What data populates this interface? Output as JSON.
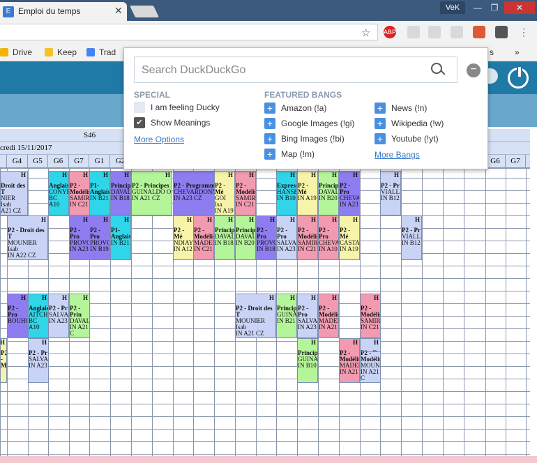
{
  "browser": {
    "tab_title": "Emploi du temps",
    "tab_icon": "E",
    "user_label": "VeK",
    "win_min": "—",
    "win_max": "❐",
    "win_close": "✕",
    "star_icon": "☆",
    "ext_abp": "ABP",
    "bookmarks": [
      {
        "label": "Drive",
        "color": "#f4b400"
      },
      {
        "label": "Keep",
        "color": "#f6c026"
      },
      {
        "label": "Trad",
        "color": "#4285f4"
      }
    ],
    "bookmark_partial": "s",
    "bookmark_more": "»"
  },
  "timetable": {
    "week_label": "S46",
    "date_label": "credi 15/11/2017",
    "groups_left": [
      "G4",
      "G5",
      "G6",
      "G7",
      "G1",
      "G2"
    ],
    "groups_right": [
      "G6",
      "G7"
    ]
  },
  "duckduckgo": {
    "search_placeholder": "Search DuckDuckGo",
    "minus_label": "−",
    "special_heading": "SPECIAL",
    "featured_heading": "FEATURED BANGS",
    "special_options": [
      {
        "label": "I am feeling Ducky",
        "checked": false
      },
      {
        "label": "Show Meanings",
        "checked": true
      }
    ],
    "more_options": "More Options",
    "bangs_col1": [
      "Amazon (!a)",
      "Google Images (!gi)",
      "Bing Images (!bi)",
      "Map (!m)"
    ],
    "bangs_col2": [
      "News (!n)",
      "Wikipedia (!w)",
      "Youtube (!yt)"
    ],
    "more_bangs": "More Bangs",
    "plus_symbol": "+",
    "check_symbol": "✔"
  },
  "events": [
    {
      "title": "Droit des T",
      "teacher": "NIER Isab",
      "room": "A21 CZ",
      "color": "#c9d3f5"
    },
    {
      "title": "Anglais",
      "teacher": "CONYB",
      "room": "BC A10",
      "color": "#2fd5e8"
    },
    {
      "title": "P2 - Modélis",
      "teacher": "SAMIR",
      "room": "IN C21",
      "color": "#f29ab0"
    },
    {
      "title": "P1- Anglais",
      "teacher": "",
      "room": "IN B21",
      "color": "#2fd5e8"
    },
    {
      "title": "Principe",
      "teacher": "DAVAL",
      "room": "IN B18",
      "color": "#8e7df0"
    },
    {
      "title": "P2 - Principes",
      "teacher": "GUINALDO O",
      "room": "IN A21 CZ",
      "color": "#b5f59a"
    },
    {
      "title": "P2 - Programm",
      "teacher": "CHEVARDONN",
      "room": "IN A23 CZ",
      "color": "#8e7df0"
    },
    {
      "title": "P2 - Mé",
      "teacher": "GOI Isa",
      "room": "IN A19",
      "color": "#f7f3a8"
    },
    {
      "title": "P2 - Modélis",
      "teacher": "SAMIR",
      "room": "IN C21",
      "color": "#f29ab0"
    },
    {
      "title": "Express",
      "teacher": "HANSE",
      "room": "IN B10",
      "color": "#2fd5e8"
    },
    {
      "title": "P2 - Mé",
      "teacher": "",
      "room": "IN A19",
      "color": "#f7f3a8"
    },
    {
      "title": "Princip",
      "teacher": "DAVAL",
      "room": "IN B20",
      "color": "#b5f59a"
    },
    {
      "title": "P2 - Pro",
      "teacher": "CHEVA",
      "room": "IN A23",
      "color": "#8e7df0"
    },
    {
      "title": "P2 - Pr",
      "teacher": "VIALLE",
      "room": "IN B12",
      "color": "#c9d3f5"
    },
    {
      "title": "P2 - Droit des T",
      "teacher": "MOUNIER Isab",
      "room": "IN A22 CZ",
      "color": "#c9d3f5"
    },
    {
      "title": "P2 - Pro",
      "teacher": "PROVO",
      "room": "IN A23",
      "color": "#8e7df0"
    },
    {
      "title": "P2 - Pro",
      "teacher": "PROVO",
      "room": "IN B19",
      "color": "#8e7df0"
    },
    {
      "title": "P1- Anglais",
      "teacher": "",
      "room": "IN B21",
      "color": "#2fd5e8"
    },
    {
      "title": "P2 - Mé",
      "teacher": "NDIAYE",
      "room": "IN A12",
      "color": "#f7f3a8"
    },
    {
      "title": "P2 - Modélis",
      "teacher": "MADEI",
      "room": "IN C21",
      "color": "#f29ab0"
    },
    {
      "title": "Princip",
      "teacher": "DAVAL",
      "room": "IN B18",
      "color": "#b5f59a"
    },
    {
      "title": "Princip",
      "teacher": "DAVAL",
      "room": "IN B20",
      "color": "#b5f59a"
    },
    {
      "title": "P2 - Pro",
      "teacher": "PROVO",
      "room": "IN B18",
      "color": "#8e7df0"
    },
    {
      "title": "P2 - Pro",
      "teacher": "SALVA",
      "room": "IN A23",
      "color": "#c9d3f5"
    },
    {
      "title": "P2 - Modélis",
      "teacher": "SAMIR",
      "room": "IN C21",
      "color": "#f29ab0"
    },
    {
      "title": "P2 - Pro",
      "teacher": "CHEVA",
      "room": "IN A10",
      "color": "#f29ab0"
    },
    {
      "title": "P2 - Mé",
      "teacher": "CASTA",
      "room": "IN A19",
      "color": "#f7f3a8"
    },
    {
      "title": "P2 - Pr",
      "teacher": "VIALLE",
      "room": "IN B12",
      "color": "#c9d3f5"
    },
    {
      "title": "P2 - Pro",
      "teacher": "BOUHO",
      "room": "",
      "color": "#8e7df0"
    },
    {
      "title": "Anglais",
      "teacher": "AITCH",
      "room": "BC A10",
      "color": "#2fd5e8"
    },
    {
      "title": "P2 - Pr",
      "teacher": "SALVA",
      "room": "IN A23",
      "color": "#c9d3f5"
    },
    {
      "title": "P2 - Prin",
      "teacher": "DAVAL",
      "room": "IN A21 C",
      "color": "#b5f59a"
    },
    {
      "title": "P2 - Droit des T",
      "teacher": "MOUNIER Isab",
      "room": "IN A21 CZ",
      "color": "#c9d3f5"
    },
    {
      "title": "Princip",
      "teacher": "GUINA",
      "room": "IN B21",
      "color": "#b5f59a"
    },
    {
      "title": "P2 - Pro",
      "teacher": "SALVA",
      "room": "IN A23",
      "color": "#c9d3f5"
    },
    {
      "title": "P2 - Modélis",
      "teacher": "MADEI",
      "room": "IN A21",
      "color": "#f29ab0"
    },
    {
      "title": "P2 - Modélis",
      "teacher": "SAMIR",
      "room": "IN C21",
      "color": "#f29ab0"
    },
    {
      "title": "P2 - Pr",
      "teacher": "SALVA",
      "room": "IN A23",
      "color": "#c9d3f5"
    },
    {
      "title": "Princip",
      "teacher": "GUINA",
      "room": "IN B10",
      "color": "#b5f59a"
    },
    {
      "title": "P2 - Modélis",
      "teacher": "MADEI",
      "room": "IN A21",
      "color": "#f29ab0"
    },
    {
      "title": "P2 - Modélis",
      "teacher": "MOUNIE",
      "room": "IN A21 C",
      "color": "#c9d3f5"
    },
    {
      "title": "P2 - Dr",
      "teacher": "",
      "room": "",
      "color": "#c9d3f5"
    },
    {
      "title": "P2 - Modélis",
      "teacher": "",
      "room": "",
      "color": "#f7f3a8"
    },
    {
      "title": "P2 - Pr",
      "teacher": "SALVA",
      "room": "IN A23",
      "color": "#c9d3f5"
    }
  ]
}
